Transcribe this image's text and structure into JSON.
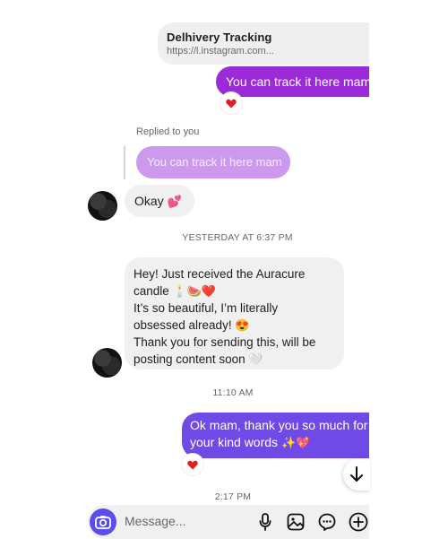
{
  "link_card": {
    "title": "Delhivery Tracking",
    "url": "https://l.instagram.com..."
  },
  "messages": {
    "outgoing_1": "You can track it here mam",
    "reaction_heart": "♥",
    "replied_label": "Replied to you",
    "reply_quote": "You can track it here mam",
    "incoming_okay": "Okay",
    "incoming_okay_emoji": "💕",
    "timestamp_1": "YESTERDAY AT 6:37 PM",
    "long_lines": [
      "Hey! Just received the Auracure",
      "candle",
      "It’s so beautiful, I’m literally",
      "obsessed already!",
      "Thank you for sending this, will be",
      "posting content soon"
    ],
    "timestamp_2": "11:10 AM",
    "outgoing_2": "Ok mam, thank you so much for your kind words",
    "outgoing_2_emoji": "✨💖",
    "timestamp_3": "2:17 PM"
  },
  "composer": {
    "placeholder": "Message..."
  },
  "icons": [
    "camera-icon",
    "microphone-icon",
    "gallery-icon",
    "sticker-icon",
    "plus-icon",
    "arrow-down-icon",
    "heart-icon"
  ],
  "colors": {
    "outgoing_purple": "#9b2bd8",
    "outgoing_violet": "#6f4ae6",
    "camera_blue": "#5b4cf0",
    "reaction_red": "#e02020"
  }
}
